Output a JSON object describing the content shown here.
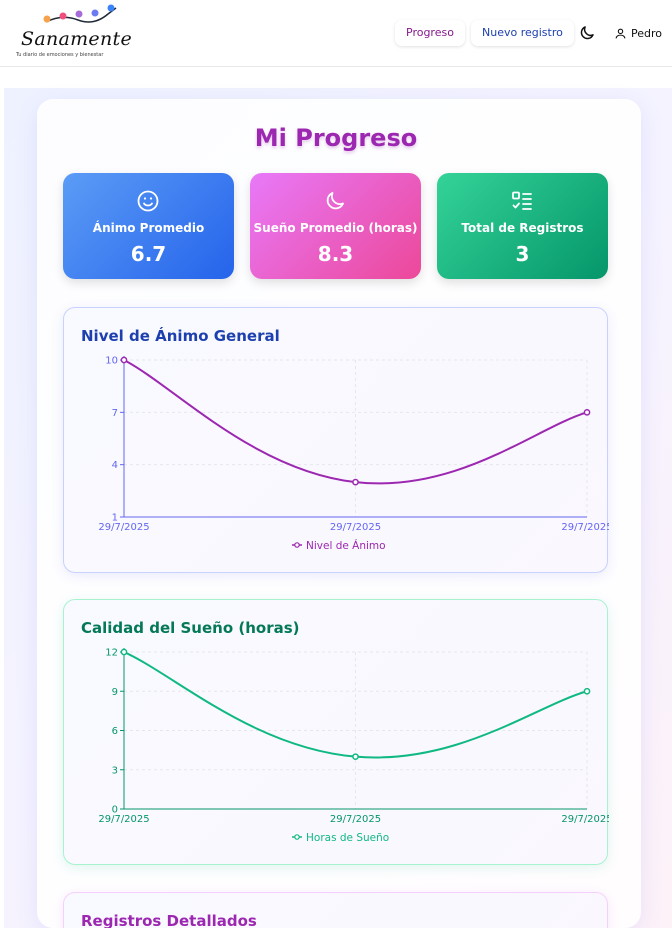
{
  "header": {
    "logo_text": "Sanamente",
    "logo_subtitle": "Tu diario de emociones y bienestar",
    "nav": {
      "progreso": "Progreso",
      "nuevo_registro": "Nuevo registro"
    },
    "user_name": "Pedro"
  },
  "page": {
    "title": "Mi Progreso"
  },
  "stats": [
    {
      "label": "Ánimo Promedio",
      "value": "6.7",
      "icon": "smile-icon"
    },
    {
      "label": "Sueño Promedio (horas)",
      "value": "8.3",
      "icon": "moon-icon"
    },
    {
      "label": "Total de Registros",
      "value": "3",
      "icon": "checklist-icon"
    }
  ],
  "charts": {
    "mood_title": "Nivel de Ánimo General",
    "sleep_title": "Calidad del Sueño (horas)",
    "details_title": "Registros Detallados"
  },
  "colors": {
    "mood": "#9c27b0",
    "mood_axis": "#6366f1",
    "sleep": "#10b981",
    "sleep_axis": "#059669"
  },
  "chart_data": [
    {
      "type": "line",
      "title": "Nivel de Ánimo General",
      "categories": [
        "29/7/2025",
        "29/7/2025",
        "29/7/2025"
      ],
      "series": [
        {
          "name": "Nivel de Ánimo",
          "values": [
            10,
            3,
            7
          ]
        }
      ],
      "yticks": [
        1,
        4,
        7,
        10
      ],
      "ylim": [
        1,
        10
      ],
      "grid": true,
      "legend": "bottom"
    },
    {
      "type": "line",
      "title": "Calidad del Sueño (horas)",
      "categories": [
        "29/7/2025",
        "29/7/2025",
        "29/7/2025"
      ],
      "series": [
        {
          "name": "Horas de Sueño",
          "values": [
            12,
            4,
            9
          ]
        }
      ],
      "yticks": [
        0,
        3,
        6,
        9,
        12
      ],
      "ylim": [
        0,
        12
      ],
      "grid": true,
      "legend": "bottom"
    }
  ]
}
